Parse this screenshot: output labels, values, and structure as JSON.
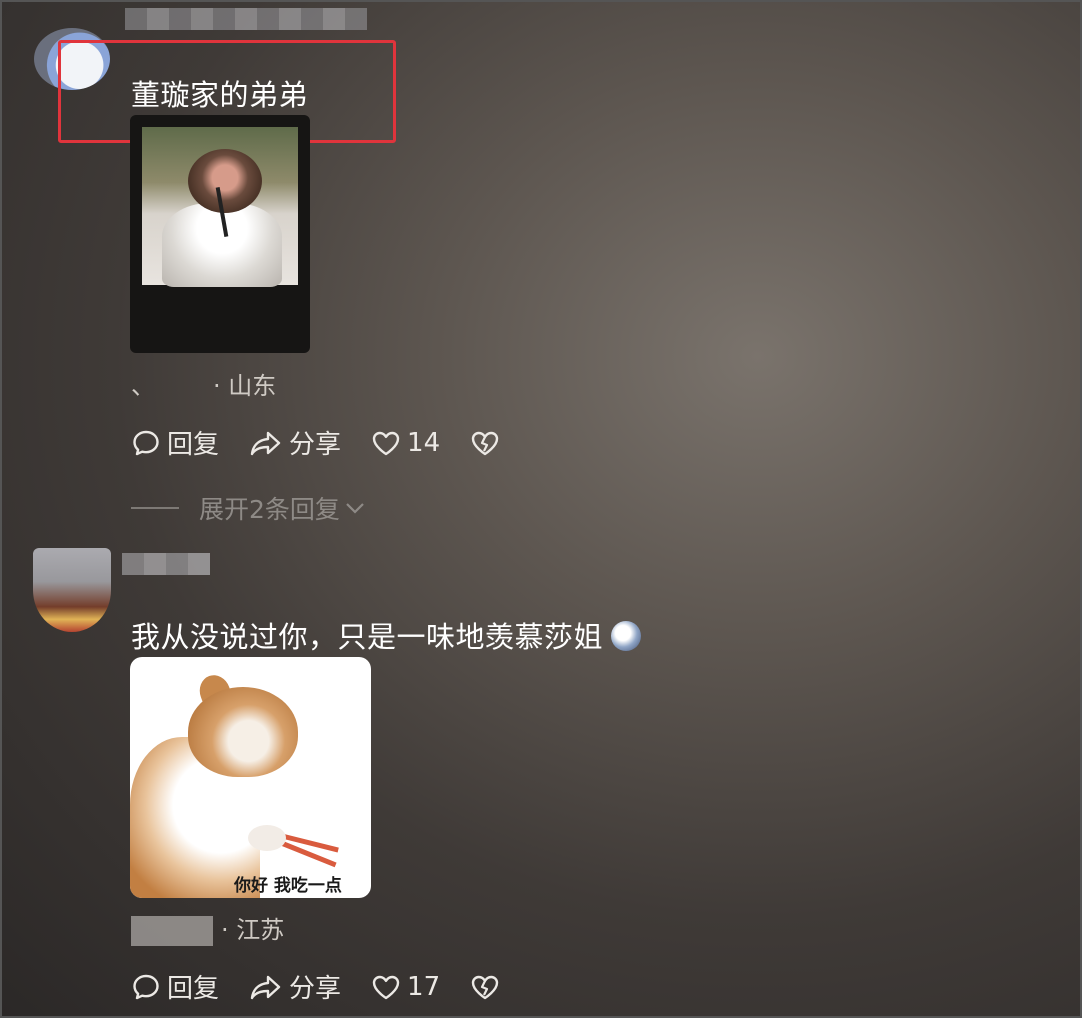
{
  "comment1": {
    "text": "董璇家的弟弟",
    "location": "· 山东",
    "reply_label": "回复",
    "share_label": "分享",
    "like_count": "14",
    "expand_label": "展开2条回复"
  },
  "comment2": {
    "text": "我从没说过你，只是一味地羡慕莎姐",
    "sticker_caption": "你好 我吃一点",
    "location": "· 江苏",
    "reply_label": "回复",
    "share_label": "分享",
    "like_count": "17"
  },
  "colors": {
    "highlight": "#e0343c",
    "text": "#ffffff",
    "muted": "#8e8a86"
  }
}
